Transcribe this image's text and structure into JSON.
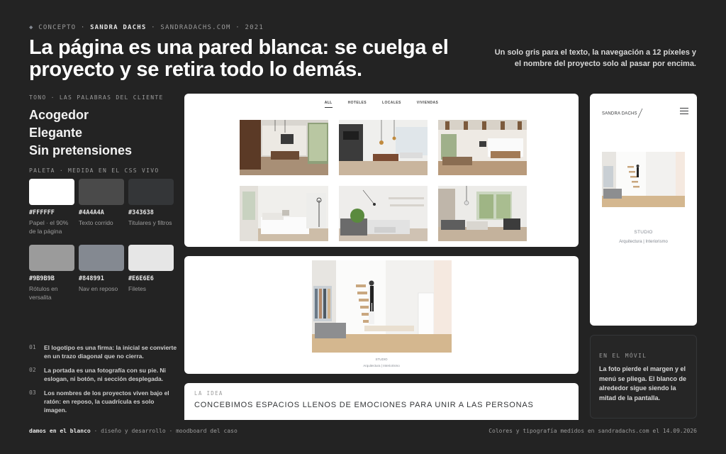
{
  "header": {
    "crumb_concept": "CONCEPTO",
    "crumb_name": "SANDRA DACHS",
    "crumb_site": "SANDRADACHS.COM",
    "crumb_year": "2021",
    "headline": "La página es una pared blanca: se cuelga el proyecto y se retira todo lo demás.",
    "lede": "Un solo gris para el texto, la navegación a 12 píxeles y el nombre del proyecto solo al pasar por encima."
  },
  "tone": {
    "label": "TONO · LAS PALABRAS DEL CLIENTE",
    "words": [
      "Acogedor",
      "Elegante",
      "Sin pretensiones"
    ]
  },
  "palette": {
    "label": "PALETA · MEDIDA EN EL CSS VIVO",
    "swatches": [
      {
        "hex": "#FFFFFF",
        "desc": "Papel · el 90% de la página"
      },
      {
        "hex": "#4A4A4A",
        "desc": "Texto corrido"
      },
      {
        "hex": "#343638",
        "desc": "Titulares y filtros"
      },
      {
        "hex": "#9B9B9B",
        "desc": "Rótulos en versalita"
      },
      {
        "hex": "#848991",
        "desc": "Nav en reposo"
      },
      {
        "hex": "#E6E6E6",
        "desc": "Filetes"
      }
    ]
  },
  "notes": [
    {
      "n": "01",
      "text": "El logotipo es una firma: la inicial se convierte en un trazo diagonal que no cierra."
    },
    {
      "n": "02",
      "text": "La portada es una fotografía con su pie. Ni eslogan, ni botón, ni sección desplegada."
    },
    {
      "n": "03",
      "text": "Los nombres de los proyectos viven bajo el ratón: en reposo, la cuadrícula es solo imagen."
    }
  ],
  "site_grid": {
    "filters": [
      "ALL",
      "HOTELES",
      "LOCALES",
      "VIVIENDAS"
    ],
    "active_filter": "ALL"
  },
  "hero": {
    "caption_title": "STUDIO",
    "caption_sub": "Arquitectura | Interiorismo"
  },
  "idea": {
    "label": "LA IDEA",
    "text": "CONCEBIMOS ESPACIOS LLENOS DE EMOCIONES PARA UNIR A LAS PERSONAS"
  },
  "mobile": {
    "logo": "SANDRA DACHS",
    "title": "STUDIO",
    "subtitle": "Arquitectura | Interiorismo",
    "note_label": "EN EL MÓVIL",
    "note_text": "La foto pierde el margen y el menú se pliega. El blanco de alrededor sigue siendo la mitad de la pantalla."
  },
  "footer": {
    "left_bold": "damos en el blanco",
    "left_rest": " · diseño y desarrollo · moodboard del caso",
    "right": "Colores y tipografía medidos en sandradachs.com el 14.09.2026"
  }
}
